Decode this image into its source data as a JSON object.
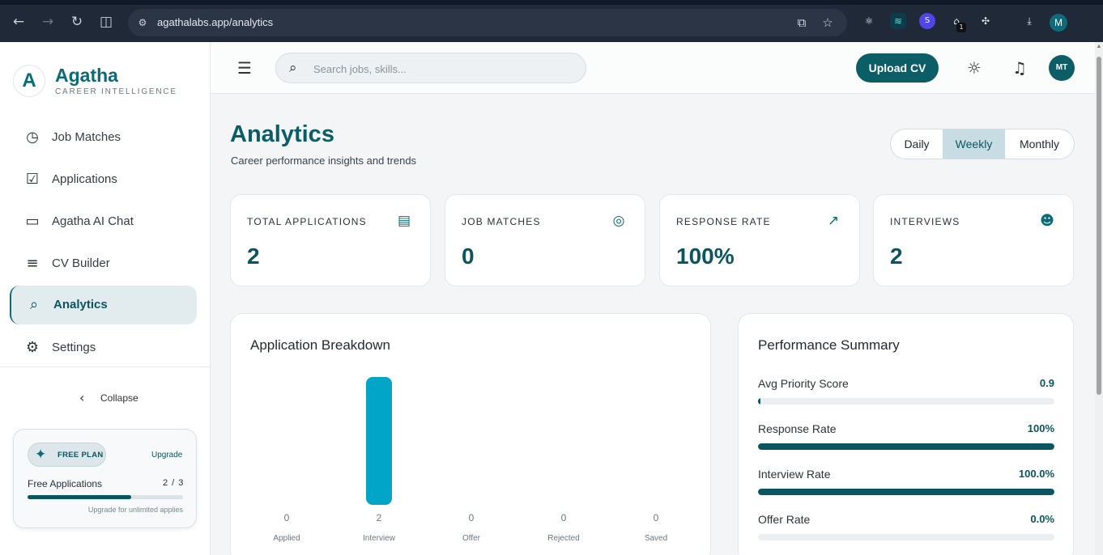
{
  "browser": {
    "url": "agathalabs.app/analytics",
    "profile_initial": "M",
    "extension_badge": "1",
    "extension_s": "S"
  },
  "brand": {
    "name": "Agatha",
    "tagline": "CAREER INTELLIGENCE",
    "logo_letter": "A"
  },
  "sidebar": {
    "items": [
      {
        "label": "Job Matches",
        "icon": "calendar-clock-icon"
      },
      {
        "label": "Applications",
        "icon": "document-check-icon"
      },
      {
        "label": "Agatha AI Chat",
        "icon": "chat-icon"
      },
      {
        "label": "CV Builder",
        "icon": "edit-list-icon"
      },
      {
        "label": "Analytics",
        "icon": "analytics-icon",
        "active": true
      },
      {
        "label": "Settings",
        "icon": "gear-icon"
      }
    ],
    "collapse_label": "Collapse"
  },
  "plan": {
    "badge": "FREE PLAN",
    "upgrade": "Upgrade",
    "usage_label": "Free Applications",
    "usage_count": "2 / 3",
    "usage_fraction": 0.667,
    "hint": "Upgrade for unlimited applies"
  },
  "header": {
    "search_placeholder": "Search jobs, skills...",
    "upload_label": "Upload CV",
    "avatar_initials": "MT"
  },
  "page": {
    "title": "Analytics",
    "subtitle": "Career performance insights and trends",
    "periods": [
      "Daily",
      "Weekly",
      "Monthly"
    ],
    "active_period": "Weekly"
  },
  "stats": [
    {
      "label": "TOTAL APPLICATIONS",
      "value": "2",
      "icon": "document-icon"
    },
    {
      "label": "JOB MATCHES",
      "value": "0",
      "icon": "match-icon"
    },
    {
      "label": "RESPONSE RATE",
      "value": "100%",
      "icon": "trending-up-icon"
    },
    {
      "label": "INTERVIEWS",
      "value": "2",
      "icon": "people-icon"
    }
  ],
  "breakdown": {
    "title": "Application Breakdown"
  },
  "chart_data": {
    "type": "bar",
    "categories": [
      "Applied",
      "Interview",
      "Offer",
      "Rejected",
      "Saved"
    ],
    "values": [
      0,
      2,
      0,
      0,
      0
    ],
    "value_labels": [
      "0",
      "2",
      "0",
      "0",
      "0"
    ],
    "bar_color": "#00a5c8"
  },
  "summary": {
    "title": "Performance Summary",
    "metrics": [
      {
        "label": "Avg Priority Score",
        "value": "0.9",
        "fraction": 0.009
      },
      {
        "label": "Response Rate",
        "value": "100%",
        "fraction": 1.0
      },
      {
        "label": "Interview Rate",
        "value": "100.0%",
        "fraction": 1.0
      },
      {
        "label": "Offer Rate",
        "value": "0.0%",
        "fraction": 0.0
      }
    ]
  },
  "colors": {
    "brand": "#0b5e66",
    "accent": "#0b6b76",
    "bar": "#00a5c8"
  }
}
